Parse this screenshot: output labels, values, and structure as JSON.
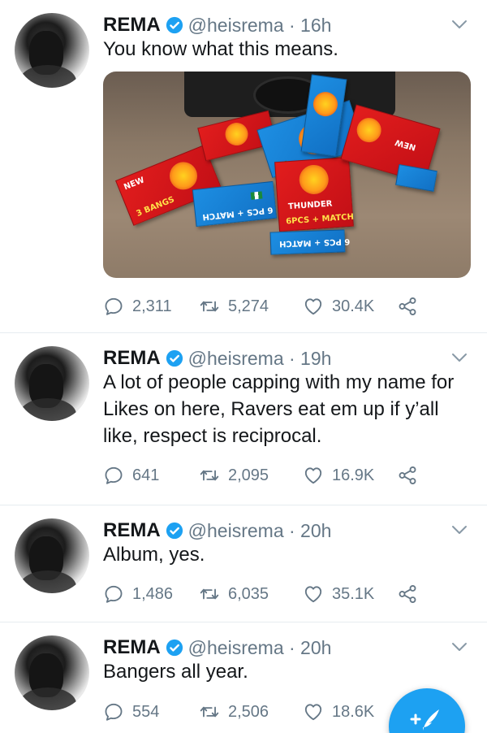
{
  "colors": {
    "accent": "#1da1f2",
    "text": "#14171a",
    "secondary": "#657786",
    "divider": "#e6ecf0"
  },
  "icons": {
    "reply": "reply-icon",
    "retweet": "retweet-icon",
    "like": "like-icon",
    "share": "share-icon",
    "verified": "verified-badge-icon",
    "more": "chevron-down-icon",
    "compose": "compose-tweet-icon"
  },
  "tweets": [
    {
      "name": "REMA",
      "handle": "@heisrema · 16h",
      "text": "You know what this means.",
      "has_media": true,
      "media_text": {
        "bangs": "3 BANGS",
        "thunder": "THUNDER",
        "match": "6PCS + MATCH",
        "match2": "6 PCS + MATCH",
        "new": "NEW"
      },
      "replies": "2,311",
      "retweets": "5,274",
      "likes": "30.4K"
    },
    {
      "name": "REMA",
      "handle": "@heisrema · 19h",
      "text": "A lot of people capping with my name for\nLikes on here, Ravers eat em up if y’all\nlike, respect is reciprocal.",
      "replies": "641",
      "retweets": "2,095",
      "likes": "16.9K"
    },
    {
      "name": "REMA",
      "handle": "@heisrema · 20h",
      "text": "Album, yes.",
      "replies": "1,486",
      "retweets": "6,035",
      "likes": "35.1K"
    },
    {
      "name": "REMA",
      "handle": "@heisrema · 20h",
      "text": "Bangers all year.",
      "replies": "554",
      "retweets": "2,506",
      "likes": "18.6K"
    }
  ]
}
